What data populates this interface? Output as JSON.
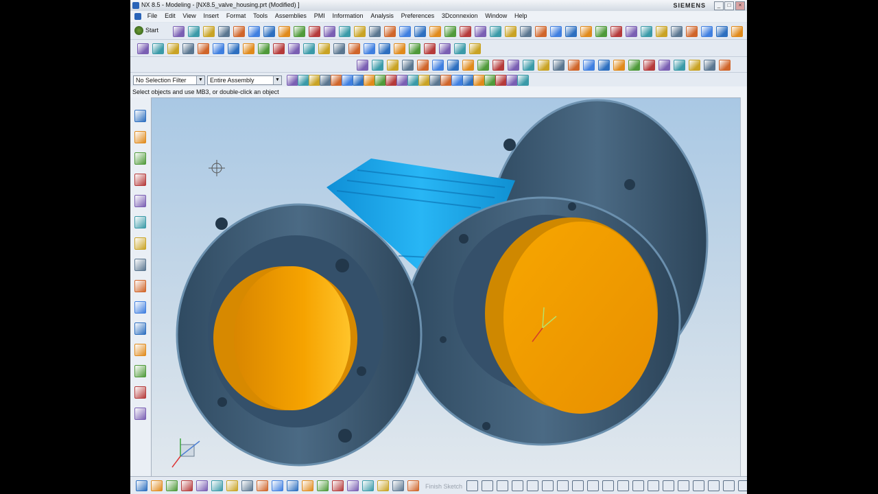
{
  "window": {
    "title": "NX 8.5 - Modeling - [NX8.5_valve_housing.prt (Modified) ]",
    "brand": "SIEMENS"
  },
  "menu": [
    "File",
    "Edit",
    "View",
    "Insert",
    "Format",
    "Tools",
    "Assemblies",
    "PMI",
    "Information",
    "Analysis",
    "Preferences",
    "3Dconnexion",
    "Window",
    "Help"
  ],
  "toolbar": {
    "start_label": "Start"
  },
  "filters": {
    "selection_filter": "No Selection Filter",
    "scope": "Entire Assembly"
  },
  "cue_line": "Select objects and use MB3, or double-click an object",
  "sketch": {
    "finish_label": "Finish Sketch"
  },
  "colors": {
    "body": "#3d5a73",
    "cap": "#f3a200",
    "highlight": "#18a9ef",
    "background_top": "#a9c8e4"
  }
}
